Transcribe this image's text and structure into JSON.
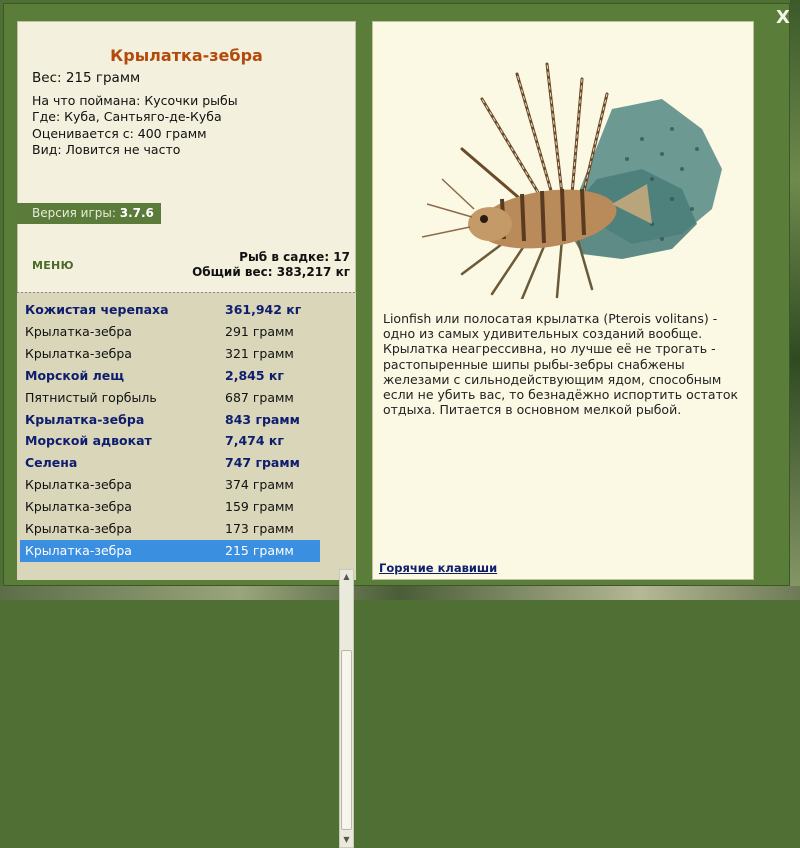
{
  "close_label": "X",
  "fish": {
    "title": "Крылатка-зебра",
    "weight": "Вес: 215 грамм",
    "details": [
      "На что поймана: Кусочки рыбы",
      "Где: Куба, Сантьяго-де-Куба",
      "Оценивается с: 400 грамм",
      "Вид: Ловится не часто"
    ],
    "description": "Lionfish или полосатая крылатка (Pterois volitans) - одно из самых удивительных созданий вообще. Крылатка неагрессивна, но лучше её не трогать - растопыренные шипы рыбы-зебры снабжены железами с сильнодействующим ядом, способным если не убить вас, то безнадёжно испортить остаток отдыха. Питается в основном мелкой рыбой."
  },
  "version": {
    "label": "Версия игры:",
    "value": "3.7.6"
  },
  "menu_label": "МЕНЮ",
  "stats": {
    "fish_count": "Рыб в садке: 17",
    "total_weight": "Общий вес: 383,217 кг"
  },
  "catch_list": [
    {
      "name": "Кожистая черепаха",
      "weight": "361,942 кг",
      "bold": true,
      "selected": false
    },
    {
      "name": "Крылатка-зебра",
      "weight": "291 грамм",
      "bold": false,
      "selected": false
    },
    {
      "name": "Крылатка-зебра",
      "weight": "321 грамм",
      "bold": false,
      "selected": false
    },
    {
      "name": "Морской лещ",
      "weight": "2,845 кг",
      "bold": true,
      "selected": false
    },
    {
      "name": "Пятнистый горбыль",
      "weight": "687 грамм",
      "bold": false,
      "selected": false
    },
    {
      "name": "Крылатка-зебра",
      "weight": "843 грамм",
      "bold": true,
      "selected": false
    },
    {
      "name": "Морской адвокат",
      "weight": "7,474 кг",
      "bold": true,
      "selected": false
    },
    {
      "name": "Селена",
      "weight": "747 грамм",
      "bold": true,
      "selected": false
    },
    {
      "name": "Крылатка-зебра",
      "weight": "374 грамм",
      "bold": false,
      "selected": false
    },
    {
      "name": "Крылатка-зебра",
      "weight": "159 грамм",
      "bold": false,
      "selected": false
    },
    {
      "name": "Крылатка-зебра",
      "weight": "173 грамм",
      "bold": false,
      "selected": false
    },
    {
      "name": "Крылатка-зебра",
      "weight": "215 грамм",
      "bold": false,
      "selected": true
    }
  ],
  "hotkeys_label": "Горячие клавиши",
  "colors": {
    "frame": "#5a7e3a",
    "title": "#b34a0c",
    "bold_row": "#0e1d6e",
    "selection": "#3a8fe0"
  }
}
